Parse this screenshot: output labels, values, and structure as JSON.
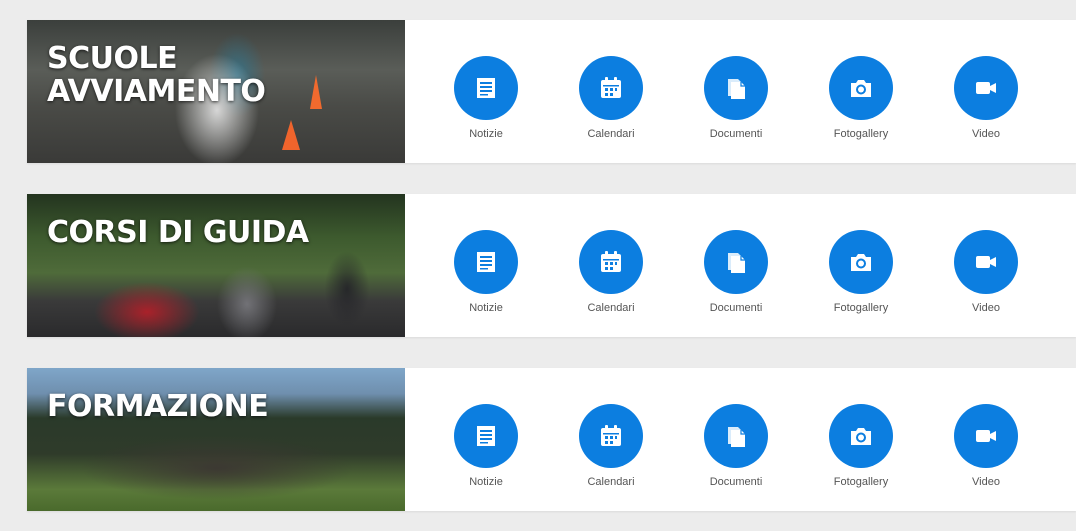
{
  "theme": {
    "accent": "#0c7ee0",
    "background": "#ececec",
    "label_color": "#555555"
  },
  "sections": [
    {
      "title": "SCUOLE\nAVVIAMENTO",
      "links": [
        {
          "label": "Notizie",
          "icon": "news-icon"
        },
        {
          "label": "Calendari",
          "icon": "calendar-icon"
        },
        {
          "label": "Documenti",
          "icon": "documents-icon"
        },
        {
          "label": "Fotogallery",
          "icon": "camera-icon"
        },
        {
          "label": "Video",
          "icon": "video-camera-icon"
        }
      ]
    },
    {
      "title": "CORSI DI GUIDA",
      "links": [
        {
          "label": "Notizie",
          "icon": "news-icon"
        },
        {
          "label": "Calendari",
          "icon": "calendar-icon"
        },
        {
          "label": "Documenti",
          "icon": "documents-icon"
        },
        {
          "label": "Fotogallery",
          "icon": "camera-icon"
        },
        {
          "label": "Video",
          "icon": "video-camera-icon"
        }
      ]
    },
    {
      "title": "FORMAZIONE",
      "links": [
        {
          "label": "Notizie",
          "icon": "news-icon"
        },
        {
          "label": "Calendari",
          "icon": "calendar-icon"
        },
        {
          "label": "Documenti",
          "icon": "documents-icon"
        },
        {
          "label": "Fotogallery",
          "icon": "camera-icon"
        },
        {
          "label": "Video",
          "icon": "video-camera-icon"
        }
      ]
    }
  ]
}
